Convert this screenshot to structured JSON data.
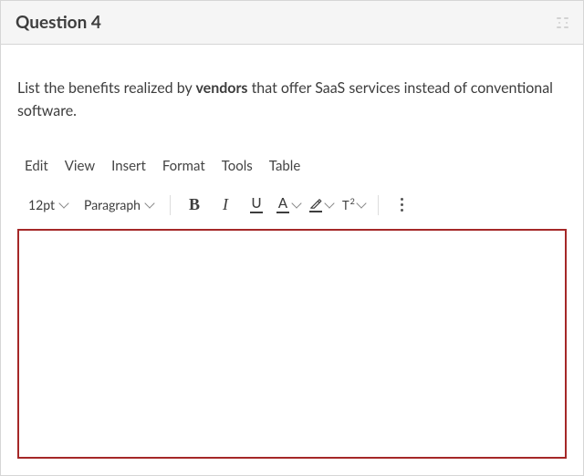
{
  "header": {
    "title": "Question 4"
  },
  "prompt": {
    "pre": "List the benefits realized by ",
    "bold": "vendors",
    "post": " that offer SaaS services instead of conventional software."
  },
  "editor": {
    "menus": {
      "edit": "Edit",
      "view": "View",
      "insert": "Insert",
      "format": "Format",
      "tools": "Tools",
      "table": "Table"
    },
    "toolbar": {
      "font_size": "12pt",
      "block_format": "Paragraph",
      "text_color_letter": "A",
      "underline_letter": "U",
      "superscript_base": "T",
      "superscript_exp": "2"
    }
  }
}
